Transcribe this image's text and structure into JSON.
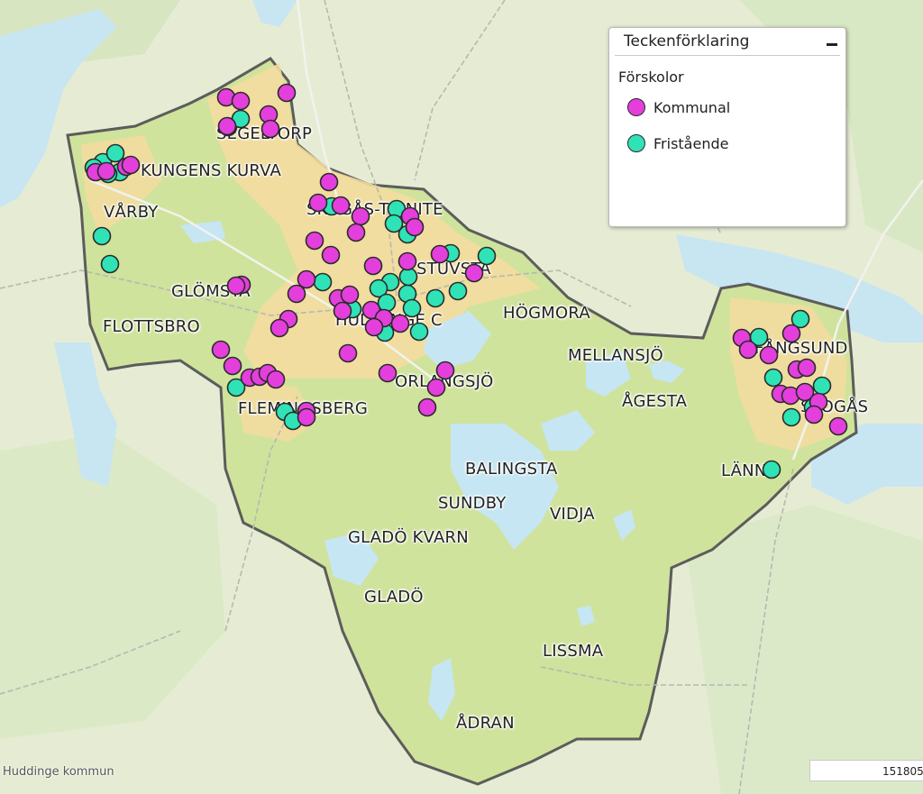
{
  "legend": {
    "title": "Teckenförklaring",
    "subtitle": "Förskolor",
    "items": [
      {
        "label": "Kommunal",
        "color": "#e43fdc"
      },
      {
        "label": "Fristående",
        "color": "#2fe3b7"
      }
    ]
  },
  "colors": {
    "kommunal": "#e43fdc",
    "fristaende": "#2fe3b7",
    "municipality_fill": "#cfe39c",
    "urban_fill": "#f3dca0",
    "water": "#c6e6f3",
    "border": "#5c5c5c"
  },
  "places": [
    {
      "name": "SEGELTORP"
    },
    {
      "name": "KUNGENS KURVA"
    },
    {
      "name": "VÅRBY"
    },
    {
      "name": "SKOGÅS-TRINITE"
    },
    {
      "name": "STUVSTA"
    },
    {
      "name": "GLÖMSTA"
    },
    {
      "name": "FLOTTSBRO"
    },
    {
      "name": "HUDDINGE C"
    },
    {
      "name": "HÖGMORA"
    },
    {
      "name": "MELLANSJÖ"
    },
    {
      "name": "ORLANGSJÖ"
    },
    {
      "name": "FLEMINGSBERG"
    },
    {
      "name": "ÅGESTA"
    },
    {
      "name": "FÅNGSUND"
    },
    {
      "name": "SKOGÅS"
    },
    {
      "name": "LÄNNA"
    },
    {
      "name": "BALINGSTA"
    },
    {
      "name": "SUNDBY"
    },
    {
      "name": "VIDJA"
    },
    {
      "name": "GLADÖ KVARN"
    },
    {
      "name": "GLADÖ"
    },
    {
      "name": "LISSMA"
    },
    {
      "name": "ÅDRAN"
    }
  ],
  "attribution": "Huddinge kommun",
  "scale": "151805,"
}
